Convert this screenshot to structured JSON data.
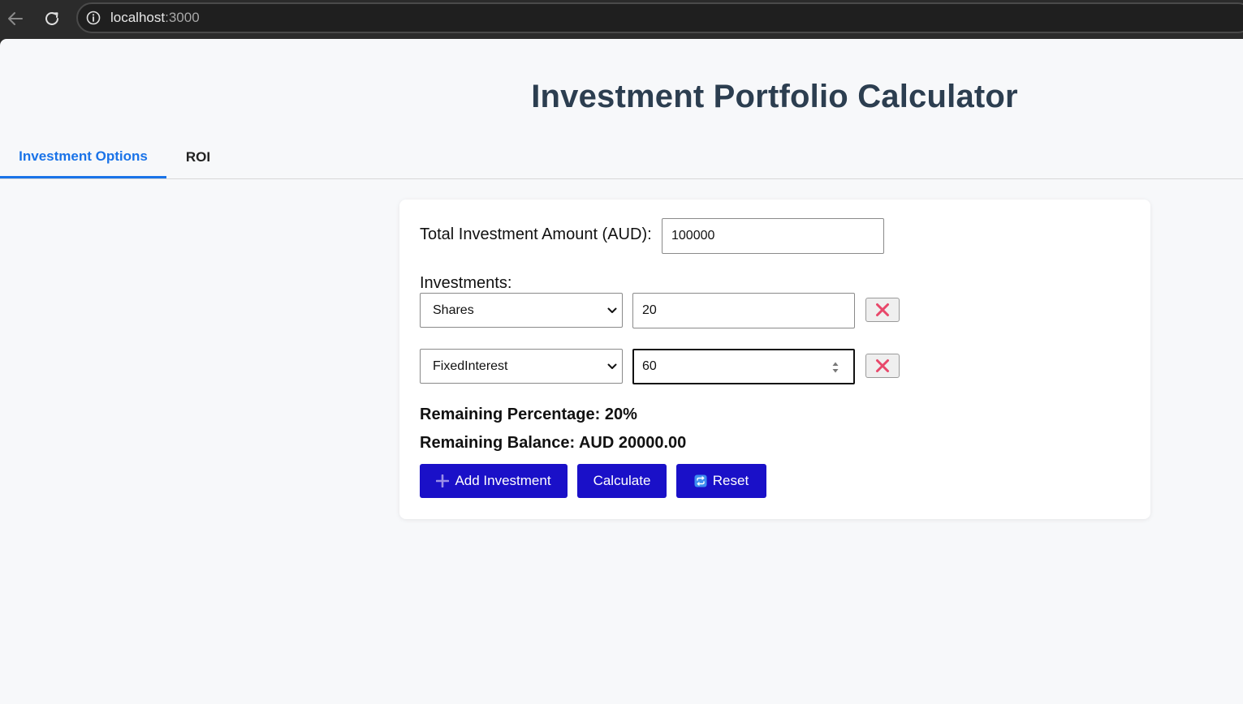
{
  "browser": {
    "url_host": "localhost",
    "url_port": ":3000"
  },
  "page": {
    "title": "Investment Portfolio Calculator"
  },
  "tabs": [
    {
      "label": "Investment Options",
      "active": true
    },
    {
      "label": "ROI",
      "active": false
    }
  ],
  "form": {
    "total_label": "Total Investment Amount (AUD):",
    "total_value": "100000",
    "investments_label": "Investments:",
    "investments": [
      {
        "type": "Shares",
        "percent": "20"
      },
      {
        "type": "FixedInterest",
        "percent": "60"
      }
    ],
    "remaining_percentage": "Remaining Percentage: 20%",
    "remaining_balance": "Remaining Balance: AUD 20000.00"
  },
  "buttons": {
    "add_label": "Add Investment",
    "calculate_label": "Calculate",
    "reset_label": "Reset"
  },
  "icons": {
    "back": "arrow-left-icon",
    "reload": "reload-icon",
    "info": "info-icon",
    "remove": "cross-mark-icon",
    "add": "plus-icon",
    "reset": "repeat-icon",
    "chevron": "chevron-down-icon"
  },
  "colors": {
    "accent_tab": "#1a73e8",
    "button_bg": "#1a10c8",
    "title": "#2c3e50",
    "remove_icon": "#e8476a"
  }
}
